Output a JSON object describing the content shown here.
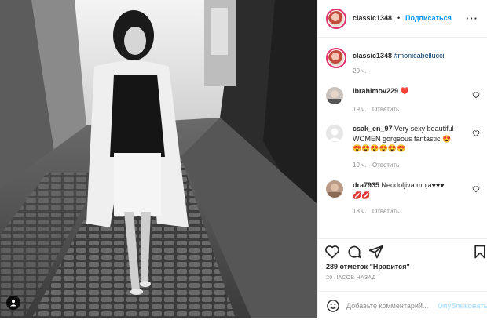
{
  "header": {
    "username": "classic1348",
    "separator": "•",
    "follow_label": "Подписаться",
    "more_label": "···"
  },
  "caption": {
    "username": "classic1348",
    "hashtag": "#monicabellucci",
    "time": "20 ч."
  },
  "comments": [
    {
      "username": "ibrahimov229",
      "text": "",
      "emoji": "❤️",
      "time": "19 ч.",
      "reply_label": "Ответить"
    },
    {
      "username": "csak_en_97",
      "text": "Very sexy beautiful WOMEN gorgeous fantastic 😍",
      "emoji_line": "😍😍😍😍😍😍",
      "time": "19 ч.",
      "reply_label": "Ответить"
    },
    {
      "username": "dra7935",
      "text": "Neodoljiva moja♥♥♥",
      "emoji_line": "💋💋",
      "time": "18 ч.",
      "reply_label": "Ответить"
    }
  ],
  "actions": {
    "likes_count": "289 отметок",
    "likes_suffix": "\"Нравится\"",
    "time_ago": "20 ЧАСОВ НАЗАД"
  },
  "add_comment": {
    "placeholder": "Добавьте комментарий...",
    "publish_label": "Опубликовать"
  },
  "colors": {
    "accent": "#0095f6",
    "like_red": "#ed4956",
    "muted": "#8e8e8e",
    "border": "#efefef"
  },
  "icons": [
    "user-tag-icon",
    "more-icon",
    "heart-icon",
    "comment-icon",
    "share-icon",
    "bookmark-icon",
    "emoji-icon"
  ]
}
